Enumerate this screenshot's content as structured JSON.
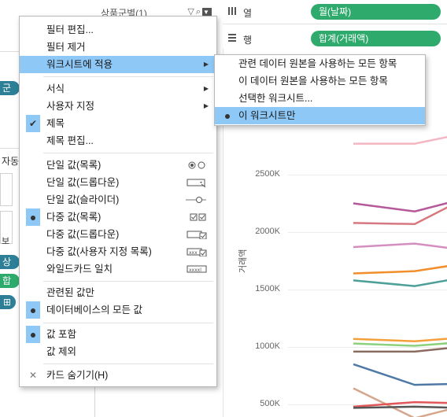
{
  "filter_card": {
    "title": "상품군별(1)"
  },
  "shelves": {
    "columns": {
      "icon": "columns-icon",
      "label": "열",
      "pill": "월(날짜)"
    },
    "rows": {
      "icon": "rows-icon",
      "label": "행",
      "pill": "합계(거래액)"
    }
  },
  "left_panel": {
    "chip1": "군별",
    "chip2": "상품",
    "chip3": "합계",
    "chip4": "⊞",
    "auto_label": "자동",
    "b_label": "보"
  },
  "chart_data": {
    "type": "line",
    "ylabel": "거래액",
    "yticks": [
      "2500K",
      "2000K",
      "1500K",
      "1000K",
      "500K"
    ],
    "ytick_values": [
      2500000,
      2000000,
      1500000,
      1000000,
      500000
    ],
    "series": [
      {
        "color": "#f4b6c2",
        "values": [
          2770000,
          2770000,
          2850000
        ]
      },
      {
        "color": "#b6599a",
        "values": [
          2250000,
          2180000,
          2280000
        ]
      },
      {
        "color": "#d6787f",
        "values": [
          2080000,
          2070000,
          2270000
        ]
      },
      {
        "color": "#d48ec0",
        "values": [
          1870000,
          1900000,
          1850000
        ]
      },
      {
        "color": "#f28e2b",
        "values": [
          1640000,
          1660000,
          1720000
        ]
      },
      {
        "color": "#4e9f98",
        "values": [
          1580000,
          1530000,
          1600000
        ]
      },
      {
        "color": "#f4a03a",
        "values": [
          1070000,
          1050000,
          1080000
        ]
      },
      {
        "color": "#8cd17d",
        "values": [
          1030000,
          1010000,
          1040000
        ]
      },
      {
        "color": "#8a6b5f",
        "values": [
          960000,
          960000,
          1000000
        ]
      },
      {
        "color": "#4e79a7",
        "values": [
          850000,
          670000,
          680000
        ]
      },
      {
        "color": "#d4a68c",
        "values": [
          640000,
          380000,
          480000
        ]
      },
      {
        "color": "#e15759",
        "values": [
          480000,
          520000,
          510000
        ]
      },
      {
        "color": "#555555",
        "values": [
          470000,
          480000,
          470000
        ]
      }
    ]
  },
  "menu": {
    "items": [
      {
        "label": "필터 편집..."
      },
      {
        "label": "필터 제거"
      },
      {
        "label": "워크시트에 적용"
      },
      {
        "label": "서식"
      },
      {
        "label": "사용자 지정"
      },
      {
        "label": "제목"
      },
      {
        "label": "제목 편집..."
      },
      {
        "label": "단일 값(목록)"
      },
      {
        "label": "단일 값(드롭다운)"
      },
      {
        "label": "단일 값(슬라이더)"
      },
      {
        "label": "다중 값(목록)"
      },
      {
        "label": "다중 값(드롭다운)"
      },
      {
        "label": "다중 값(사용자 지정 목록)"
      },
      {
        "label": "와일드카드 일치"
      },
      {
        "label": "관련된 값만"
      },
      {
        "label": "데이터베이스의 모든 값"
      },
      {
        "label": "값 포함"
      },
      {
        "label": "값 제외"
      },
      {
        "label": "카드 숨기기(H)"
      }
    ],
    "wildcard_icon_text": "xxxxl",
    "custom_list_icon_text": "xxx"
  },
  "submenu": {
    "items": [
      {
        "label": "관련 데이터 원본을 사용하는 모든 항목"
      },
      {
        "label": "이 데이터 원본을 사용하는 모든 항목"
      },
      {
        "label": "선택한 워크시트..."
      },
      {
        "label": "이 워크시트만"
      }
    ]
  }
}
